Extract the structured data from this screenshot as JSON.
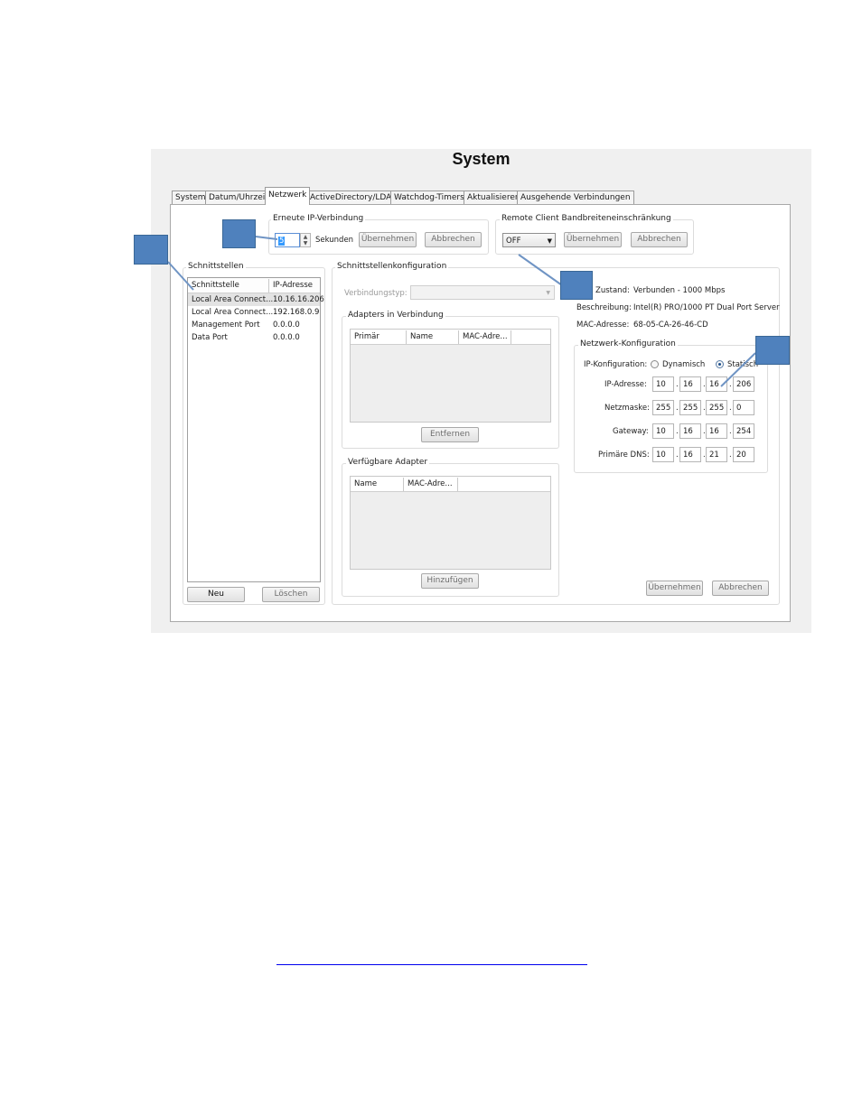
{
  "window": {
    "title": "System"
  },
  "tabs": [
    "System",
    "Datum/Uhrzeit",
    "Netzwerk",
    "ActiveDirectory/LDAP",
    "Watchdog-Timers",
    "Aktualisieren",
    "Ausgehende Verbindungen"
  ],
  "active_tab": "Netzwerk",
  "reconnect": {
    "group_label": "Erneute IP-Verbindung",
    "value": "5",
    "unit_label": "Sekunden",
    "apply_label": "Übernehmen",
    "cancel_label": "Abbrechen"
  },
  "bandwidth": {
    "group_label": "Remote Client Bandbreiteneinschränkung",
    "selected": "OFF",
    "apply_label": "Übernehmen",
    "cancel_label": "Abbrechen"
  },
  "interfaces": {
    "group_label": "Schnittstellen",
    "columns": [
      "Schnittstelle",
      "IP-Adresse"
    ],
    "rows": [
      {
        "name": "Local Area Connect...",
        "ip": "10.16.16.206"
      },
      {
        "name": "Local Area Connect...",
        "ip": "192.168.0.9"
      },
      {
        "name": "Management Port",
        "ip": "0.0.0.0"
      },
      {
        "name": "Data Port",
        "ip": "0.0.0.0"
      }
    ],
    "new_label": "Neu",
    "delete_label": "Löschen"
  },
  "config": {
    "group_label": "Schnittstellenkonfiguration",
    "connection_type_label": "Verbindungstyp:",
    "connected_adapters": {
      "label": "Adapters in Verbindung",
      "columns": [
        "Primär",
        "Name",
        "MAC-Adre..."
      ],
      "remove_label": "Entfernen"
    },
    "available_adapters": {
      "label": "Verfügbare Adapter",
      "columns": [
        "Name",
        "MAC-Adre..."
      ],
      "add_label": "Hinzufügen"
    }
  },
  "info": {
    "state_label": "Zustand:",
    "state_value": "Verbunden - 1000 Mbps",
    "desc_label": "Beschreibung:",
    "desc_value": "Intel(R) PRO/1000 PT Dual Port Server",
    "mac_label": "MAC-Adresse:",
    "mac_value": "68-05-CA-26-46-CD"
  },
  "netconfig": {
    "group_label": "Netzwerk-Konfiguration",
    "ipconfig_label": "IP-Konfiguration:",
    "dynamic_label": "Dynamisch",
    "static_label": "Statisch",
    "selected_mode": "Statisch",
    "ip_label": "IP-Adresse:",
    "ip": [
      "10",
      "16",
      "16",
      "206"
    ],
    "mask_label": "Netzmaske:",
    "mask": [
      "255",
      "255",
      "255",
      "0"
    ],
    "gateway_label": "Gateway:",
    "gateway": [
      "10",
      "16",
      "16",
      "254"
    ],
    "dns_label": "Primäre DNS:",
    "dns": [
      "10",
      "16",
      "21",
      "20"
    ]
  },
  "footer": {
    "apply_label": "Übernehmen",
    "cancel_label": "Abbrechen"
  },
  "colors": {
    "callout": "#4f81bd",
    "link": "#0000ee"
  }
}
